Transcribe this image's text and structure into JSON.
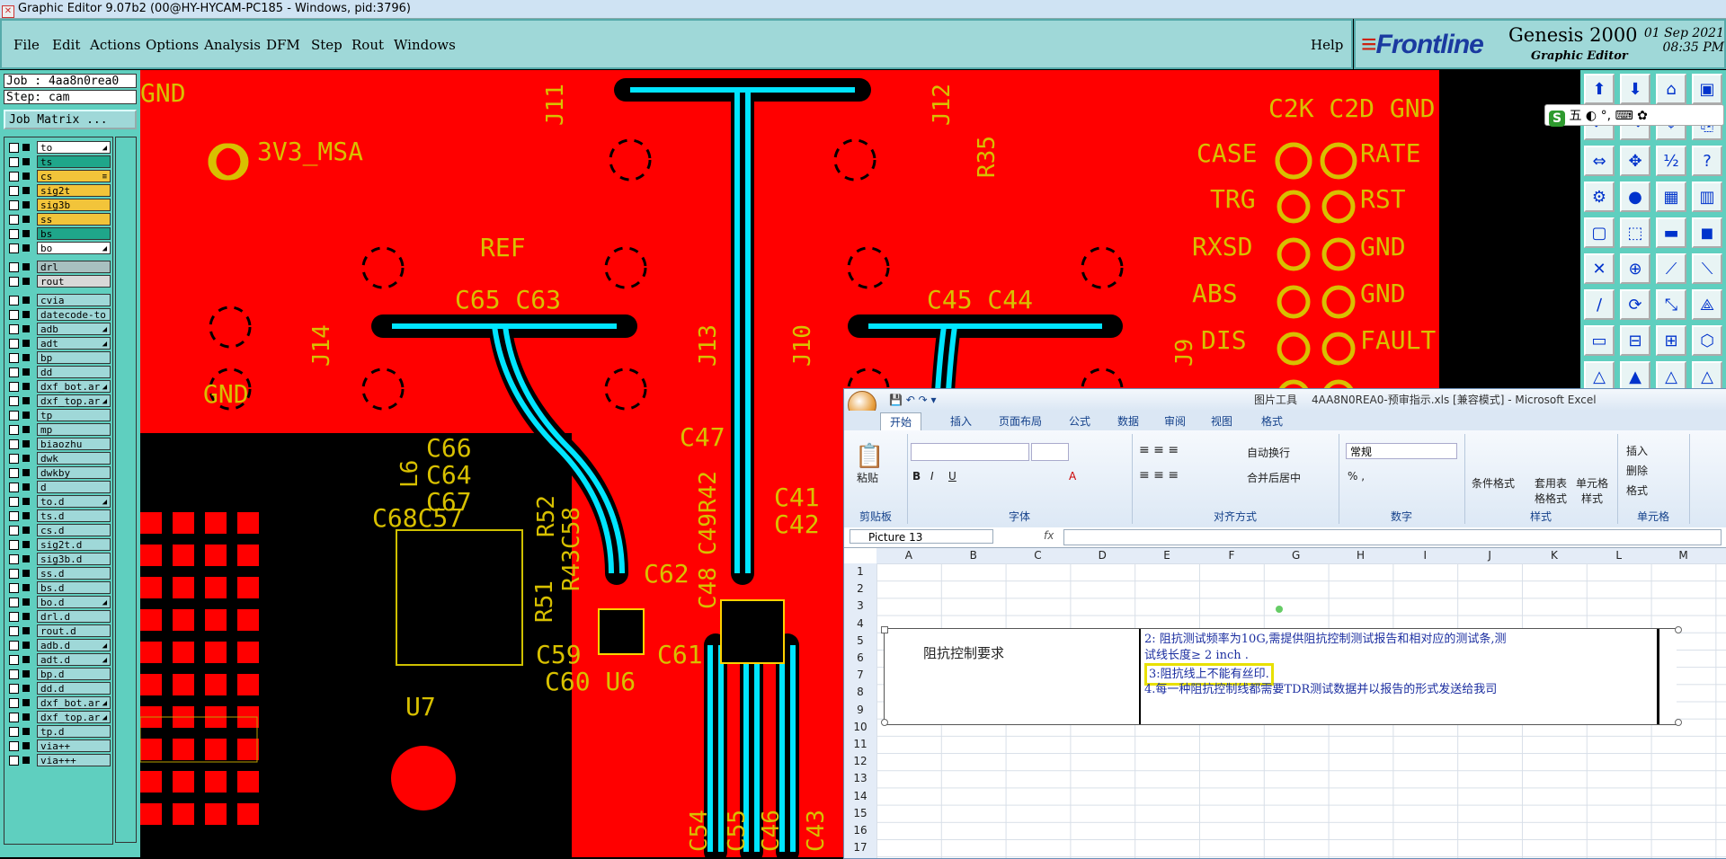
{
  "window": {
    "title": "Graphic Editor 9.07b2 (00@HY-HYCAM-PC185 - Windows, pid:3796)"
  },
  "menu": [
    "File",
    "Edit",
    "Actions",
    "Options",
    "Analysis",
    "DFM",
    "Step",
    "Rout",
    "Windows"
  ],
  "help": "Help",
  "brand": {
    "logo": "Frontline",
    "product": "Genesis 2000",
    "subtitle": "Graphic Editor",
    "date": "01 Sep 2021",
    "time": "08:35 PM"
  },
  "job": {
    "job": "Job : 4aa8n0rea0",
    "step": "Step: cam",
    "matrix_button": "Job Matrix ..."
  },
  "layers": [
    {
      "name": "to",
      "color": "#ffffff",
      "arrow": "◢"
    },
    {
      "name": "ts",
      "color": "#1fa68a",
      "arrow": ""
    },
    {
      "name": "cs",
      "color": "#f2c43a",
      "arrow": "≡"
    },
    {
      "name": "sig2t",
      "color": "#f2c43a",
      "arrow": ""
    },
    {
      "name": "sig3b",
      "color": "#f2c43a",
      "arrow": ""
    },
    {
      "name": "ss",
      "color": "#f2c43a",
      "arrow": ""
    },
    {
      "name": "bs",
      "color": "#1fa68a",
      "arrow": ""
    },
    {
      "name": "bo",
      "color": "#ffffff",
      "arrow": "◢"
    },
    {
      "name": "drl",
      "color": "#a8c0c0",
      "arrow": ""
    },
    {
      "name": "rout",
      "color": "#d8d8d8",
      "arrow": ""
    },
    {
      "name": "cvia",
      "color": "#9fd8d8",
      "arrow": ""
    },
    {
      "name": "datecode-to",
      "color": "#9fd8d8",
      "arrow": ""
    },
    {
      "name": "adb",
      "color": "#9fd8d8",
      "arrow": "◢"
    },
    {
      "name": "adt",
      "color": "#9fd8d8",
      "arrow": "◢"
    },
    {
      "name": "bp",
      "color": "#9fd8d8",
      "arrow": ""
    },
    {
      "name": "dd",
      "color": "#9fd8d8",
      "arrow": ""
    },
    {
      "name": "dxf_bot.ar",
      "color": "#9fd8d8",
      "arrow": "◢"
    },
    {
      "name": "dxf_top.ar",
      "color": "#9fd8d8",
      "arrow": "◢"
    },
    {
      "name": "tp",
      "color": "#9fd8d8",
      "arrow": ""
    },
    {
      "name": "mp",
      "color": "#9fd8d8",
      "arrow": ""
    },
    {
      "name": "biaozhu",
      "color": "#9fd8d8",
      "arrow": ""
    },
    {
      "name": "dwk",
      "color": "#9fd8d8",
      "arrow": ""
    },
    {
      "name": "dwkby",
      "color": "#9fd8d8",
      "arrow": ""
    },
    {
      "name": "d",
      "color": "#9fd8d8",
      "arrow": ""
    },
    {
      "name": "to.d",
      "color": "#9fd8d8",
      "arrow": "◢"
    },
    {
      "name": "ts.d",
      "color": "#9fd8d8",
      "arrow": ""
    },
    {
      "name": "cs.d",
      "color": "#9fd8d8",
      "arrow": ""
    },
    {
      "name": "sig2t.d",
      "color": "#9fd8d8",
      "arrow": ""
    },
    {
      "name": "sig3b.d",
      "color": "#9fd8d8",
      "arrow": ""
    },
    {
      "name": "ss.d",
      "color": "#9fd8d8",
      "arrow": ""
    },
    {
      "name": "bs.d",
      "color": "#9fd8d8",
      "arrow": ""
    },
    {
      "name": "bo.d",
      "color": "#9fd8d8",
      "arrow": "◢"
    },
    {
      "name": "drl.d",
      "color": "#9fd8d8",
      "arrow": ""
    },
    {
      "name": "rout.d",
      "color": "#9fd8d8",
      "arrow": ""
    },
    {
      "name": "adb.d",
      "color": "#9fd8d8",
      "arrow": "◢"
    },
    {
      "name": "adt.d",
      "color": "#9fd8d8",
      "arrow": "◢"
    },
    {
      "name": "bp.d",
      "color": "#9fd8d8",
      "arrow": ""
    },
    {
      "name": "dd.d",
      "color": "#9fd8d8",
      "arrow": ""
    },
    {
      "name": "dxf_bot.ar",
      "color": "#9fd8d8",
      "arrow": "◢"
    },
    {
      "name": "dxf_top.ar",
      "color": "#9fd8d8",
      "arrow": "◢"
    },
    {
      "name": "tp.d",
      "color": "#9fd8d8",
      "arrow": ""
    },
    {
      "name": "via++",
      "color": "#9fd8d8",
      "arrow": ""
    },
    {
      "name": "via+++",
      "color": "#9fd8d8",
      "arrow": ""
    }
  ],
  "pcb": {
    "labels": [
      "GND",
      "GND",
      "3V3_MSA",
      "J11",
      "J12",
      "R35",
      "C2K",
      "C2D",
      "GND",
      "CASE",
      "RATE",
      "TRG",
      "RST",
      "RXSD",
      "GND",
      "ABS",
      "GND",
      "DIS",
      "FAULT",
      "REF",
      "J14",
      "J13",
      "J10",
      "J9",
      "C65",
      "C63",
      "C45",
      "C44",
      "GND",
      "L6",
      "C66",
      "C64",
      "C67",
      "C68",
      "C57",
      "C47",
      "C49",
      "R42",
      "R52",
      "R43",
      "C58",
      "R51",
      "C41",
      "C42",
      "C48",
      "C62",
      "C59",
      "C60",
      "U6",
      "C61",
      "U7",
      "C54",
      "C55",
      "C46",
      "C43"
    ]
  },
  "ime": {
    "text": "五 ◐ °, ⌨ ✿"
  },
  "excel": {
    "title_context": "图片工具",
    "title_file": "4AA8N0REA0-预审指示.xls [兼容模式] - Microsoft Excel",
    "tabs": [
      "开始",
      "插入",
      "页面布局",
      "公式",
      "数据",
      "审阅",
      "视图",
      "格式"
    ],
    "groups": [
      "剪贴板",
      "字体",
      "对齐方式",
      "数字",
      "样式",
      "单元格"
    ],
    "buttons": {
      "paste": "粘贴",
      "wrap": "自动换行",
      "merge": "合并后居中",
      "format_conditional": "条件格式",
      "table_format": "套用表格格式",
      "cell_style": "单元格样式",
      "insert": "插入",
      "delete": "删除",
      "format": "格式",
      "number_format": "常规"
    },
    "namebox": "Picture 13",
    "fx": "fx",
    "columns": [
      "A",
      "B",
      "C",
      "D",
      "E",
      "F",
      "G",
      "H",
      "I",
      "J",
      "K",
      "L",
      "M"
    ],
    "rows": [
      "1",
      "2",
      "3",
      "4",
      "5",
      "6",
      "7",
      "8",
      "9",
      "10",
      "11",
      "12",
      "13",
      "14",
      "15",
      "16",
      "17"
    ],
    "heading": "阻抗控制要求",
    "line1": "2: 阻抗测试频率为10G,需提供阻抗控制测试报告和相对应的测试条,测",
    "line2": "试线长度≥ 2 inch .",
    "line3": "3:阻抗线上不能有丝印.",
    "line4": "4.每一种阻抗控制线都需要TDR测试数据并以报告的形式发送给我司"
  }
}
